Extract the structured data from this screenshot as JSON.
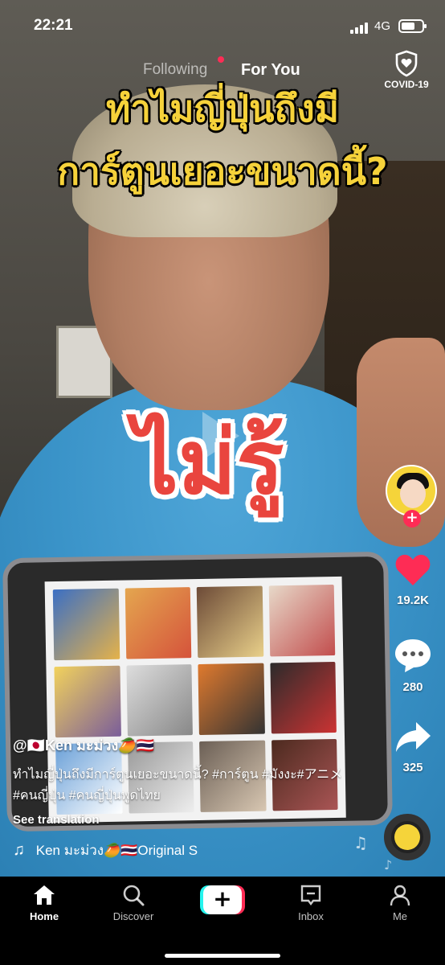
{
  "status_bar": {
    "time": "22:21",
    "network": "4G",
    "battery_level_percent": 65
  },
  "top_nav": {
    "following": "Following",
    "for_you": "For You",
    "covid_label": "COVID-19"
  },
  "video": {
    "caption_line1": "ทำไมญี่ปุ่นถึงมี",
    "caption_line2": "การ์ตูนเยอะขนาดนี้?",
    "big_word": "ไม่รู้"
  },
  "actions": {
    "likes": "19.2K",
    "comments": "280",
    "shares": "325",
    "follow_symbol": "+"
  },
  "post": {
    "username": "@🇯🇵Ken มะม่วง🥭🇹🇭",
    "description": "ทำไมญี่ปุ่นถึงมีการ์ตูนเยอะขนาดนี้? #การ์ตูน #มังงะ#アニメ #คนญี่ปุ่น #คนญี่ปุ่นพูดไทย",
    "see_translation": "See translation",
    "sound_note": "♫",
    "sound": "Ken มะม่วง🥭🇹🇭Original S"
  },
  "tabbar": {
    "home": "Home",
    "discover": "Discover",
    "create": "+",
    "inbox": "Inbox",
    "me": "Me"
  },
  "colors": {
    "accent_red": "#fe2c55",
    "accent_cyan": "#25f4ee",
    "caption_yellow": "#f6d23a",
    "big_word_red": "#e9453e"
  }
}
